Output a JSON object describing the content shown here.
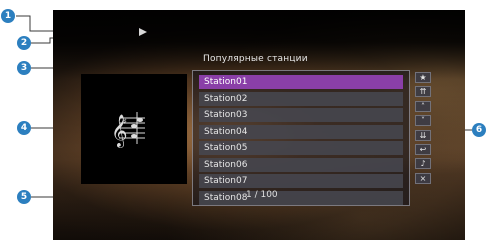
{
  "screen": {
    "title": "Популярные станции",
    "page_indicator": "1 / 100"
  },
  "stations": [
    {
      "label": "Station01",
      "selected": true
    },
    {
      "label": "Station02",
      "selected": false
    },
    {
      "label": "Station03",
      "selected": false
    },
    {
      "label": "Station04",
      "selected": false
    },
    {
      "label": "Station05",
      "selected": false
    },
    {
      "label": "Station06",
      "selected": false
    },
    {
      "label": "Station07",
      "selected": false
    },
    {
      "label": "Station08",
      "selected": false
    }
  ],
  "controls": [
    {
      "icon": "star-icon",
      "glyph": "★"
    },
    {
      "icon": "page-up-icon",
      "glyph": "⇈"
    },
    {
      "icon": "up-icon",
      "glyph": "˄"
    },
    {
      "icon": "down-icon",
      "glyph": "˅"
    },
    {
      "icon": "page-down-icon",
      "glyph": "⇊"
    },
    {
      "icon": "return-icon",
      "glyph": "↩"
    },
    {
      "icon": "music-icon",
      "glyph": "♪"
    },
    {
      "icon": "close-icon",
      "glyph": "×"
    }
  ],
  "callouts": [
    "1",
    "2",
    "3",
    "4",
    "5",
    "6"
  ],
  "colors": {
    "callout": "#2c7fbf",
    "selected_row": "#8a3fa8"
  }
}
